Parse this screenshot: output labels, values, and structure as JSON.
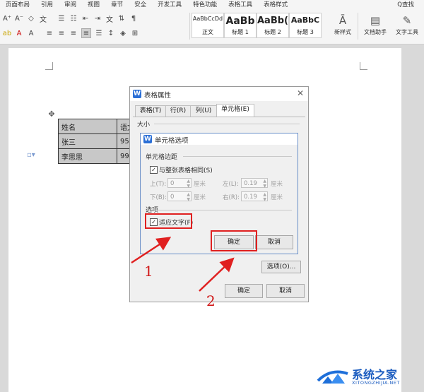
{
  "menu": {
    "items": [
      "页面布局",
      "引用",
      "审阅",
      "视图",
      "章节",
      "安全",
      "开发工具",
      "特色功能",
      "表格工具",
      "表格样式"
    ],
    "search": "Q查找"
  },
  "styles": [
    {
      "sample": "AaBbCcDd",
      "name": "正文"
    },
    {
      "sample": "AaBb",
      "name": "标题 1"
    },
    {
      "sample": "AaBb(",
      "name": "标题 2"
    },
    {
      "sample": "AaBbC",
      "name": "标题 3"
    }
  ],
  "ribbon": {
    "new_style": "新样式",
    "doc_helper": "文档助手",
    "text_tools": "文字工具"
  },
  "table": {
    "rows": [
      [
        "姓名",
        "语文"
      ],
      [
        "张三",
        "95"
      ],
      [
        "李思思",
        "99"
      ]
    ]
  },
  "outer_dialog": {
    "title": "表格属性",
    "tabs": [
      "表格(T)",
      "行(R)",
      "列(U)",
      "单元格(E)"
    ],
    "size_label": "大小",
    "options_button": "选项(O)...",
    "ok": "确定",
    "cancel": "取消"
  },
  "inner_dialog": {
    "title": "单元格选项",
    "margins_label": "单元格边距",
    "same_as_table": "与整张表格相同(S)",
    "top_label": "上(T):",
    "top_value": "0",
    "bottom_label": "下(B):",
    "bottom_value": "0",
    "left_label": "左(L):",
    "left_value": "0.19",
    "right_label": "右(R):",
    "right_value": "0.19",
    "unit": "厘米",
    "options_label": "选项",
    "fit_text": "适应文字(F)",
    "ok": "确定",
    "cancel": "取消"
  },
  "annotations": {
    "step1": "1",
    "step2": "2"
  },
  "watermark": {
    "text": "系统之家",
    "url": "XITONGZHIJIA.NET"
  },
  "colors": {
    "annotation_red": "#e02020",
    "accent_blue": "#2b6fd6"
  }
}
